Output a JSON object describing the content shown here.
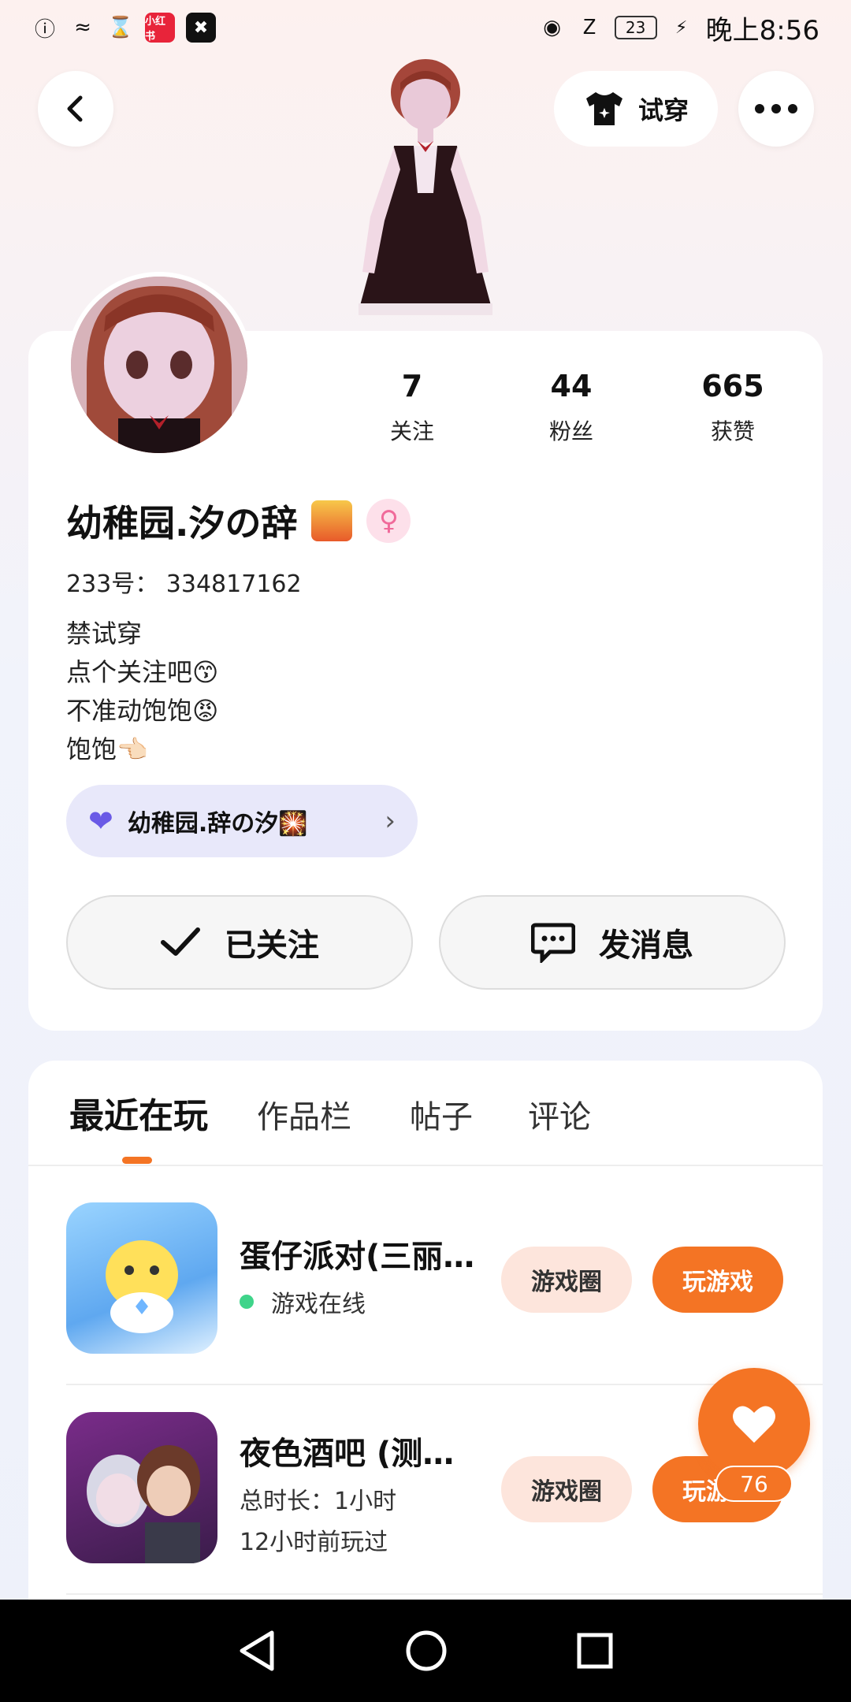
{
  "status_bar": {
    "app1": "小红书",
    "time": "晚上8:56",
    "battery": "23"
  },
  "header": {
    "try_on_label": "试穿"
  },
  "profile": {
    "stats": [
      {
        "num": "7",
        "label": "关注"
      },
      {
        "num": "44",
        "label": "粉丝"
      },
      {
        "num": "665",
        "label": "获赞"
      }
    ],
    "name": "幼稚园.汐の辞",
    "id_line": "233号： 334817162",
    "bio": [
      "禁试穿",
      "点个关注吧😙",
      "不准动饱饱😡",
      "饱饱👈🏻"
    ],
    "partner": "幼稚园.辞の汐🎇",
    "followed_label": "已关注",
    "message_label": "发消息"
  },
  "tabs": [
    "最近在玩",
    "作品栏",
    "帖子",
    "评论"
  ],
  "games": [
    {
      "title": "蛋仔派对(三丽…",
      "sub1": "游戏在线",
      "sub2": "",
      "circle_label": "游戏圈",
      "play_label": "玩游戏"
    },
    {
      "title": "夜色酒吧 (测…",
      "sub1": "总时长：1小时",
      "sub2": "12小时前玩过",
      "circle_label": "游戏圈",
      "play_label": "玩游戏"
    }
  ],
  "like_fab": {
    "count": "76"
  },
  "colors": {
    "accent": "#f47424",
    "partner_bg": "#e8e8fa",
    "online": "#3fd48a"
  }
}
